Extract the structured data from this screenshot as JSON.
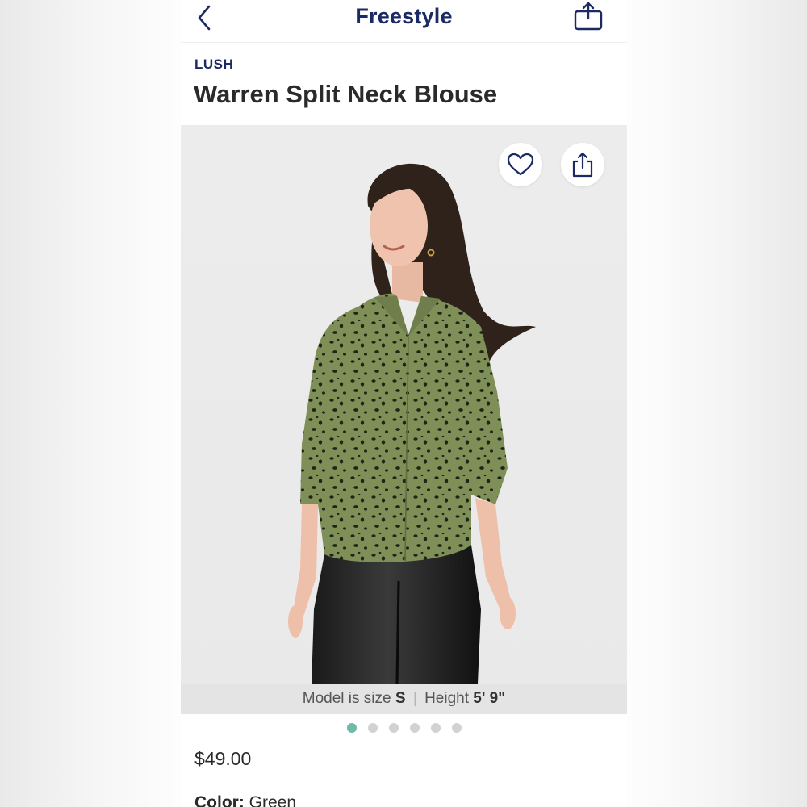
{
  "header": {
    "title": "Freestyle"
  },
  "product": {
    "brand": "LUSH",
    "title": "Warren Split Neck Blouse",
    "price": "$49.00",
    "color_label": "Color:",
    "color_value": "Green"
  },
  "image": {
    "model_info_prefix": "Model is size",
    "model_size": "S",
    "separator": "|",
    "height_label": "Height",
    "height_value": "5' 9\"",
    "carousel": {
      "total": 6,
      "active_index": 0
    }
  },
  "colors": {
    "brand_navy": "#1b2a63",
    "dot_active": "#6dbaa8",
    "dot_inactive": "#d2d2d2",
    "blouse_green": "#7f8f58"
  },
  "icons": [
    "back-chevron-icon",
    "share-icon",
    "heart-icon"
  ]
}
